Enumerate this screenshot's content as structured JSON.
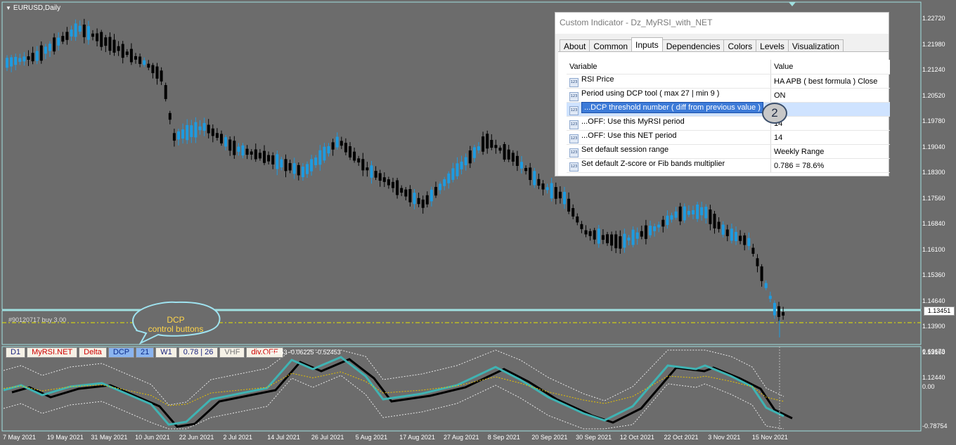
{
  "chart": {
    "symbol": "EURUSD,Daily",
    "position_label": "#90120717 buy 3.00",
    "current_price": "1.13451",
    "price_axis": [
      "1.22720",
      "1.21980",
      "1.21240",
      "1.20520",
      "1.19780",
      "1.19040",
      "1.18300",
      "1.17560",
      "1.16840",
      "1.16100",
      "1.15360",
      "1.14640",
      "1.13900",
      "1.13160",
      "1.12440"
    ],
    "indicator_axis": [
      "0.69673",
      "0.00",
      "-0.78754"
    ],
    "indicator_values": "0.52453 -0.06225 -0.52453",
    "dates": [
      "7 May 2021",
      "19 May 2021",
      "31 May 2021",
      "10 Jun 2021",
      "22 Jun 2021",
      "2 Jul 2021",
      "14 Jul 2021",
      "26 Jul 2021",
      "5 Aug 2021",
      "17 Aug 2021",
      "27 Aug 2021",
      "8 Sep 2021",
      "20 Sep 2021",
      "30 Sep 2021",
      "12 Oct 2021",
      "22 Oct 2021",
      "3 Nov 2021",
      "15 Nov 2021"
    ],
    "colors": {
      "bull": "#1e9be0",
      "bear": "#000000",
      "background": "#6c6c6c",
      "grid": "#a0e0e0",
      "fast_line": "#3fb3b3",
      "mid_line": "#e6c200"
    }
  },
  "callout": {
    "line1": "DCP",
    "line2": "control buttons"
  },
  "toolbar": {
    "items": [
      "D1",
      "MyRSI.NET",
      "Delta",
      "DCP",
      "21",
      "W1",
      "0.78 | 26",
      "VHF",
      "div.OFF"
    ]
  },
  "dialog": {
    "title": "Custom Indicator - Dz_MyRSI_with_NET",
    "tabs": [
      "About",
      "Common",
      "Inputs",
      "Dependencies",
      "Colors",
      "Levels",
      "Visualization"
    ],
    "active_tab": "Inputs",
    "columns": {
      "variable": "Variable",
      "value": "Value"
    },
    "rows": [
      {
        "icon": "123",
        "variable": "RSI Price",
        "value": "HA APB ( best formula ) Close"
      },
      {
        "icon": "123",
        "variable": "Period using DCP tool ( max 27  |  min 9 )",
        "value": "ON"
      },
      {
        "icon": "123",
        "variable": "...DCP threshold number ( diff from previous value )",
        "value": ""
      },
      {
        "icon": "123",
        "variable": "...OFF: Use this MyRSI period",
        "value": "14"
      },
      {
        "icon": "123",
        "variable": "...OFF: Use this NET period",
        "value": "14"
      },
      {
        "icon": "123",
        "variable": "Set default session range",
        "value": "Weekly Range"
      },
      {
        "icon": "123",
        "variable": "Set default Z-score or Fib bands multiplier",
        "value": "0.786 = 78.6%"
      }
    ],
    "selected_row_index": 2,
    "step_badge": "2"
  }
}
